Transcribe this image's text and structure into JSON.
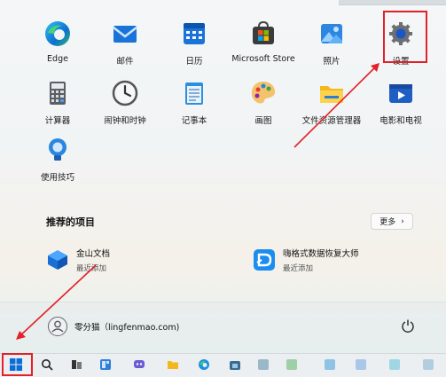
{
  "pinned": [
    {
      "label": "Edge",
      "icon": "edge-icon"
    },
    {
      "label": "邮件",
      "icon": "mail-icon"
    },
    {
      "label": "日历",
      "icon": "calendar-icon"
    },
    {
      "label": "Microsoft Store",
      "icon": "store-icon"
    },
    {
      "label": "照片",
      "icon": "photos-icon"
    },
    {
      "label": "设置",
      "icon": "settings-icon"
    },
    {
      "label": "计算器",
      "icon": "calculator-icon"
    },
    {
      "label": "闹钟和时钟",
      "icon": "clock-icon"
    },
    {
      "label": "记事本",
      "icon": "notepad-icon"
    },
    {
      "label": "画图",
      "icon": "paint-icon"
    },
    {
      "label": "文件资源管理器",
      "icon": "file-explorer-icon"
    },
    {
      "label": "电影和电视",
      "icon": "movies-icon"
    },
    {
      "label": "使用技巧",
      "icon": "tips-icon"
    }
  ],
  "recommended": {
    "title": "推荐的项目",
    "more_label": "更多",
    "items": [
      {
        "name": "金山文档",
        "sub": "最近添加",
        "icon": "kingsoft-docs-icon"
      },
      {
        "name": "嗨格式数据恢复大师",
        "sub": "最近添加",
        "icon": "data-recovery-icon"
      }
    ]
  },
  "user": {
    "name": "零分猫（lingfenmao.com)"
  },
  "colors": {
    "highlight": "#e1222a",
    "accent": "#0078d4"
  }
}
